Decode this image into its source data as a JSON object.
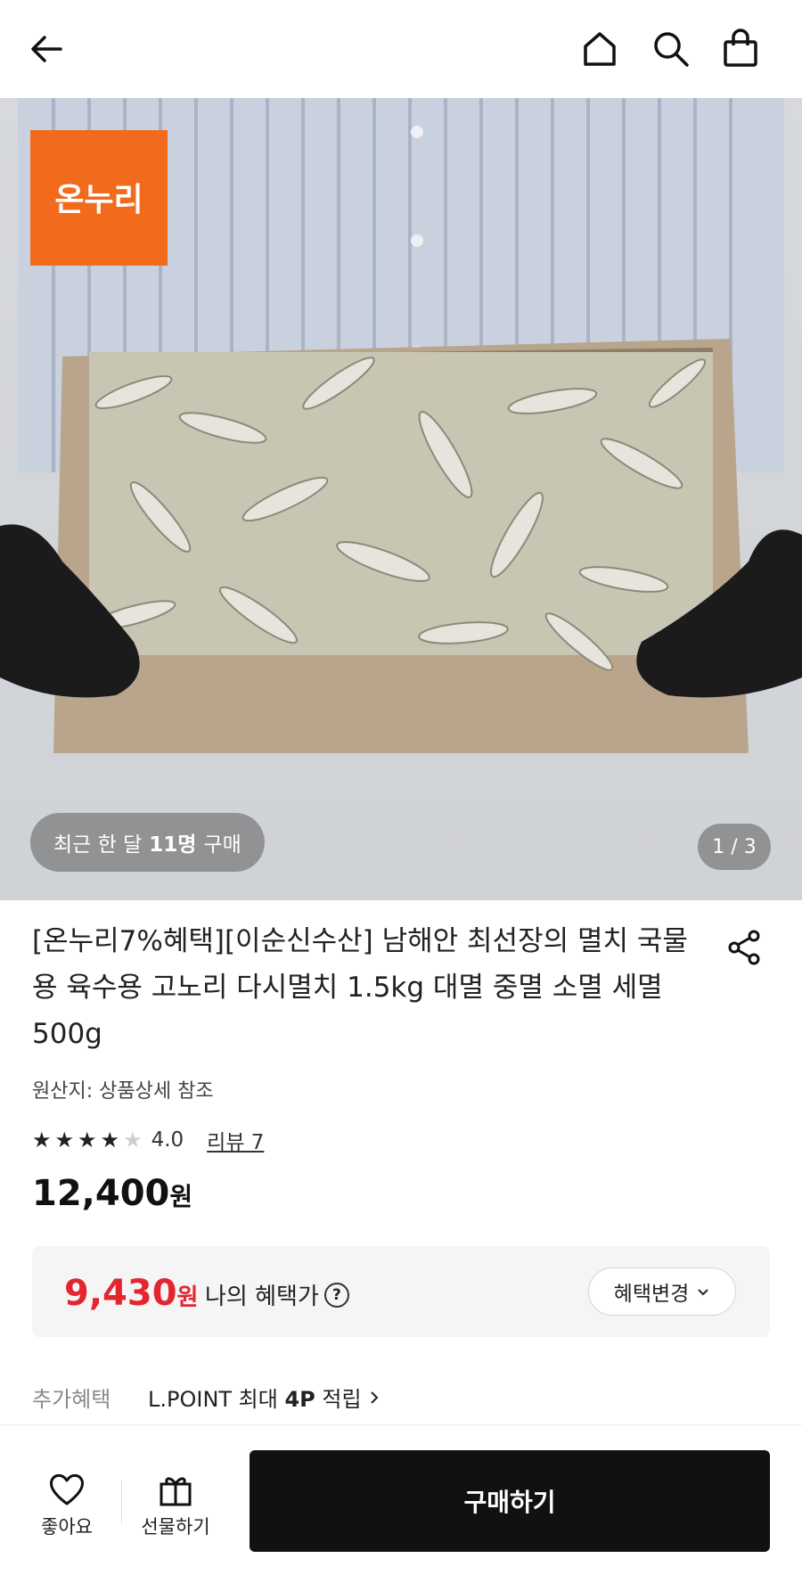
{
  "header": {
    "back_icon": "arrow-left-icon",
    "home_icon": "home-icon",
    "search_icon": "search-icon",
    "cart_icon": "shopping-bag-icon"
  },
  "hero": {
    "brand_logo_text": "온누리",
    "brand_color": "#f26a1b",
    "recent_prefix": "최근 한 달",
    "recent_count": "11명",
    "recent_suffix": "구매",
    "page_indicator": "1 / 3"
  },
  "product": {
    "title": "[온누리7%혜택][이순신수산] 남해안 최선장의 멸치 국물용 육수용 고노리 다시멸치 1.5kg 대멸 중멸 소멸 세멸 500g",
    "origin": "원산지: 상품상세 참조",
    "rating_value": 4.0,
    "rating_text": "4.0",
    "reviews_label": "리뷰 7",
    "price": "12,400",
    "price_unit": "원"
  },
  "benefit": {
    "price": "9,430",
    "price_unit": "원",
    "label": "나의 혜택가",
    "help_icon": "question-circle-icon",
    "change_label": "혜택변경",
    "accent_color": "#e3262e"
  },
  "extra_benefit": {
    "label": "추가혜택",
    "value_prefix": "L.POINT 최대",
    "value_points": "4P",
    "value_suffix": "적립"
  },
  "bottom_bar": {
    "like_label": "좋아요",
    "gift_label": "선물하기",
    "buy_label": "구매하기"
  }
}
